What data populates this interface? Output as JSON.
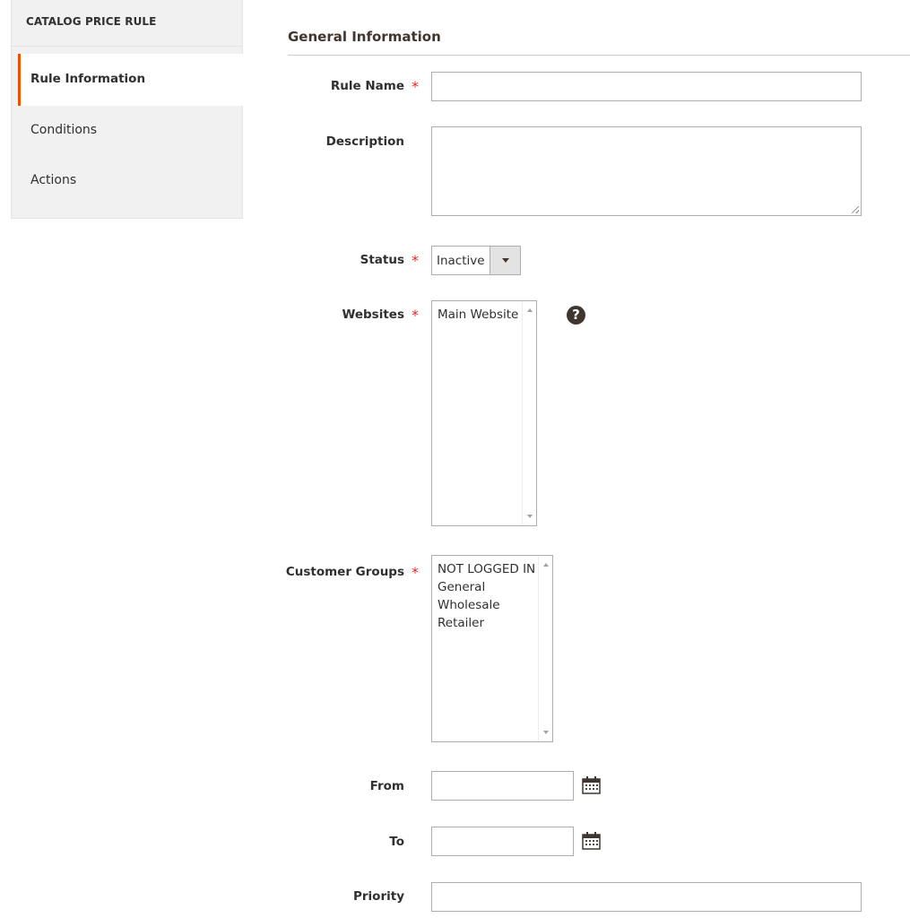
{
  "sidebar": {
    "title": "CATALOG PRICE RULE",
    "tabs": [
      {
        "label": "Rule Information",
        "active": true
      },
      {
        "label": "Conditions",
        "active": false
      },
      {
        "label": "Actions",
        "active": false
      }
    ]
  },
  "section": {
    "title": "General Information"
  },
  "form": {
    "rule_name": {
      "label": "Rule Name",
      "required": true,
      "value": ""
    },
    "description": {
      "label": "Description",
      "required": false,
      "value": ""
    },
    "status": {
      "label": "Status",
      "required": true,
      "value": "Inactive"
    },
    "websites": {
      "label": "Websites",
      "required": true,
      "options": [
        "Main Website"
      ]
    },
    "customer_groups": {
      "label": "Customer Groups",
      "required": true,
      "options": [
        "NOT LOGGED IN",
        "General",
        "Wholesale",
        "Retailer"
      ]
    },
    "from": {
      "label": "From",
      "value": ""
    },
    "to": {
      "label": "To",
      "value": ""
    },
    "priority": {
      "label": "Priority",
      "value": ""
    },
    "required_marker": "*",
    "help_glyph": "?"
  },
  "colors": {
    "accent": "#eb5202",
    "required": "#e22626",
    "sidebar_bg": "#f1f1f1",
    "text": "#303030"
  },
  "icons": {
    "help": "question-circle-icon",
    "calendar": "calendar-icon",
    "select_arrow": "chevron-down-icon"
  }
}
